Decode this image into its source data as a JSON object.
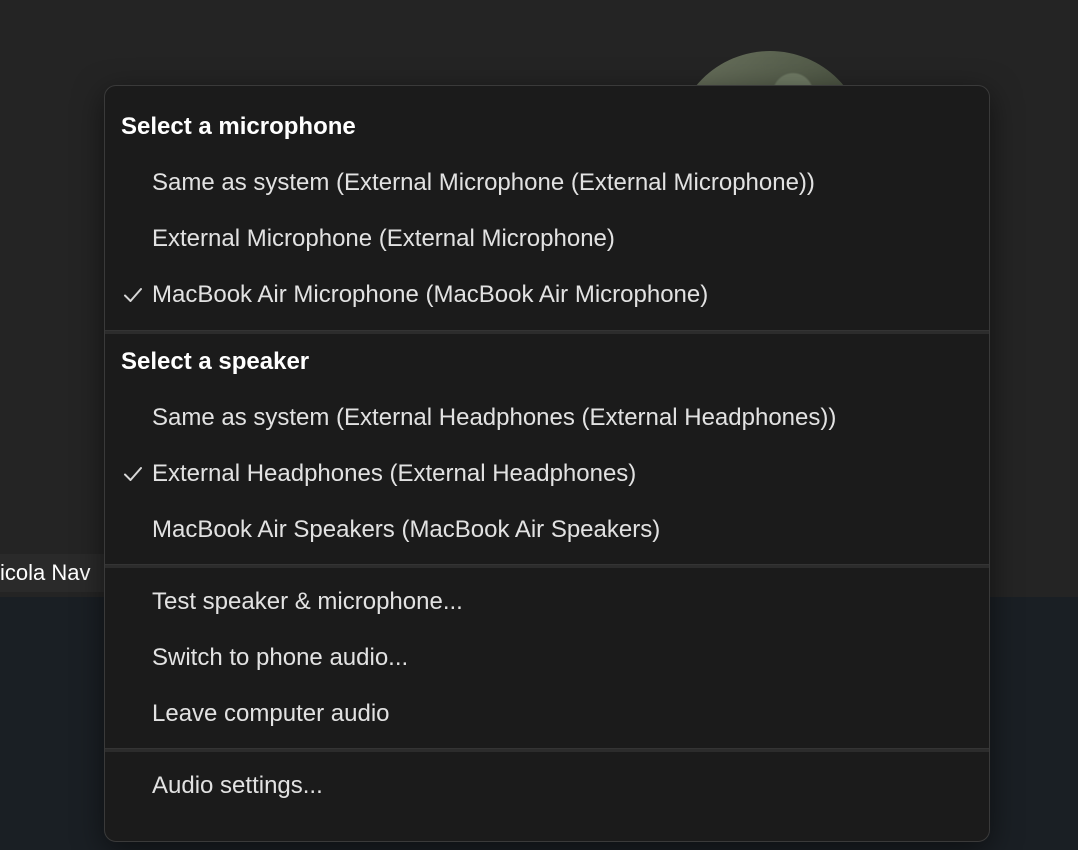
{
  "participant": {
    "name_fragment": "icola Nav"
  },
  "menu": {
    "microphone": {
      "heading": "Select a microphone",
      "items": [
        {
          "label": "Same as system (External Microphone (External Microphone))",
          "checked": false
        },
        {
          "label": "External Microphone (External Microphone)",
          "checked": false
        },
        {
          "label": "MacBook Air Microphone (MacBook Air Microphone)",
          "checked": true
        }
      ]
    },
    "speaker": {
      "heading": "Select a speaker",
      "items": [
        {
          "label": "Same as system (External Headphones (External Headphones))",
          "checked": false
        },
        {
          "label": "External Headphones (External Headphones)",
          "checked": true
        },
        {
          "label": "MacBook Air Speakers (MacBook Air Speakers)",
          "checked": false
        }
      ]
    },
    "actions": [
      {
        "label": "Test speaker & microphone..."
      },
      {
        "label": "Switch to phone audio..."
      },
      {
        "label": "Leave computer audio"
      }
    ],
    "settings_label": "Audio settings..."
  },
  "colors": {
    "menu_bg": "#1b1b1b",
    "text": "#e2e2e2",
    "heading": "#ffffff",
    "check": "#d6d6d6"
  }
}
